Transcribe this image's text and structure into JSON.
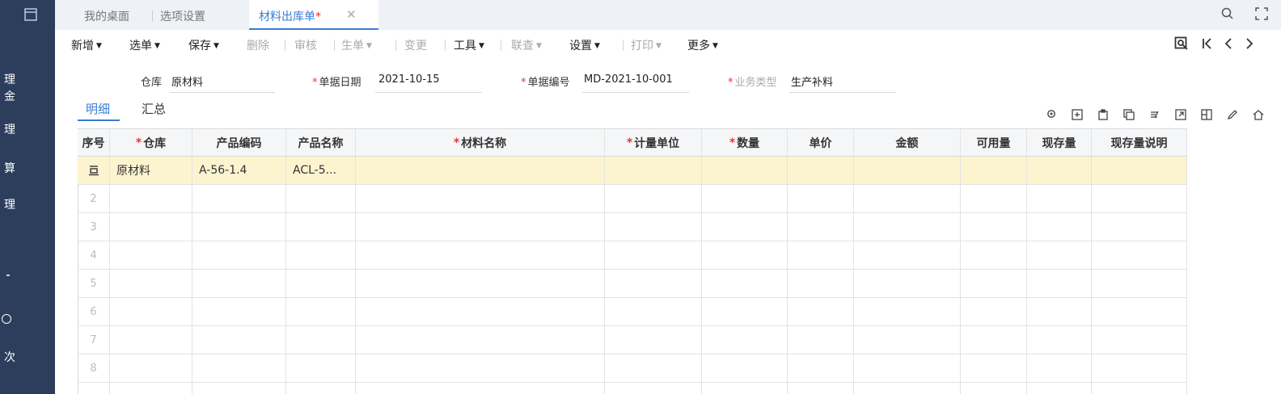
{
  "rail": {
    "logo_icon": "window-icon",
    "items": [
      "理",
      "金",
      "理",
      "算",
      "理",
      "次"
    ]
  },
  "tabs": [
    {
      "label": "我的桌面"
    },
    {
      "label": "选项设置"
    },
    {
      "label": "材料出库单",
      "modified": "*",
      "active": true
    }
  ],
  "toolbar": {
    "items": [
      {
        "label": "新增",
        "caret": true,
        "disabled": false
      },
      {
        "label": "选单",
        "caret": true,
        "disabled": false
      },
      {
        "label": "保存",
        "caret": true,
        "disabled": false
      },
      {
        "label": "删除",
        "caret": false,
        "disabled": true
      },
      {
        "label": "审核",
        "caret": false,
        "disabled": true
      },
      {
        "label": "生单",
        "caret": true,
        "disabled": true
      },
      {
        "label": "变更",
        "caret": false,
        "disabled": true
      },
      {
        "label": "工具",
        "caret": true,
        "disabled": false
      },
      {
        "label": "联查",
        "caret": true,
        "disabled": true
      },
      {
        "label": "设置",
        "caret": true,
        "disabled": false
      },
      {
        "label": "打印",
        "caret": true,
        "disabled": true
      },
      {
        "label": "更多",
        "caret": true,
        "disabled": false
      }
    ]
  },
  "form": {
    "warehouse": {
      "label": "仓库",
      "value": "原材料"
    },
    "doc_date": {
      "label": "单据日期",
      "value": "2021-10-15"
    },
    "doc_no": {
      "label": "单据编号",
      "value": "MD-2021-10-001"
    },
    "biz_type": {
      "label": "业务类型",
      "value": "生产补料"
    }
  },
  "subtabs": [
    "明细",
    "汇总"
  ],
  "grid": {
    "columns": [
      "序号",
      "仓库",
      "产品编码",
      "产品名称",
      "材料名称",
      "计量单位",
      "数量",
      "单价",
      "金额",
      "可用量",
      "现存量",
      "现存量说明"
    ],
    "required": [
      false,
      true,
      false,
      false,
      true,
      true,
      true,
      false,
      false,
      false,
      false,
      false
    ],
    "rows": [
      [
        "",
        "原材料",
        "A-56-1.4",
        "ACL-5...",
        "",
        "",
        "",
        "",
        "",
        "",
        "",
        ""
      ],
      [
        "2",
        "",
        "",
        "",
        "",
        "",
        "",
        "",
        "",
        "",
        "",
        ""
      ],
      [
        "3",
        "",
        "",
        "",
        "",
        "",
        "",
        "",
        "",
        "",
        "",
        ""
      ],
      [
        "4",
        "",
        "",
        "",
        "",
        "",
        "",
        "",
        "",
        "",
        "",
        ""
      ],
      [
        "5",
        "",
        "",
        "",
        "",
        "",
        "",
        "",
        "",
        "",
        "",
        ""
      ],
      [
        "6",
        "",
        "",
        "",
        "",
        "",
        "",
        "",
        "",
        "",
        "",
        ""
      ],
      [
        "7",
        "",
        "",
        "",
        "",
        "",
        "",
        "",
        "",
        "",
        "",
        ""
      ],
      [
        "8",
        "",
        "",
        "",
        "",
        "",
        "",
        "",
        "",
        "",
        "",
        ""
      ],
      [
        "",
        "",
        "",
        "",
        "",
        "",
        "",
        "",
        "",
        "",
        "",
        ""
      ]
    ],
    "active_row_icon": "row-edit-icon"
  },
  "colors": {
    "rail_bg": "#2c3e5c",
    "accent": "#3a7bd5",
    "required": "#e33",
    "active_row": "#fbf4cf"
  }
}
